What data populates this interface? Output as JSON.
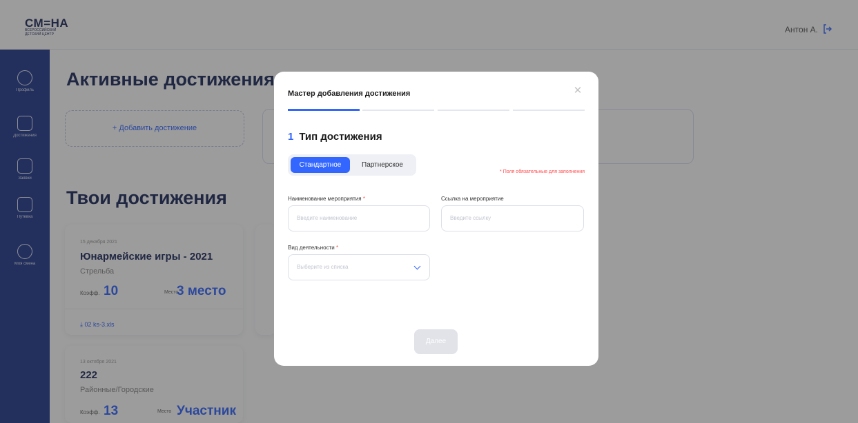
{
  "header": {
    "logo_main": "СМ=НА",
    "logo_sub1": "ВСЕРОССИЙСКИЙ",
    "logo_sub2": "ДЕТСКИЙ ЦЕНТР",
    "user_name": "Антон А."
  },
  "sidebar": {
    "items": [
      {
        "label": "Профиль",
        "icon": "profile-icon"
      },
      {
        "label": "Достижения",
        "icon": "trophy-icon"
      },
      {
        "label": "Заявки",
        "icon": "document-icon"
      },
      {
        "label": "Путевка",
        "icon": "voucher-icon"
      },
      {
        "label": "Моя смена",
        "icon": "shift-icon"
      }
    ]
  },
  "main": {
    "active_title": "Активные достижения",
    "add_label": "+ Добавить достижение",
    "my_title": "Твои достижения",
    "cards": [
      {
        "date": "15 декабря 2021",
        "title": "Юнармейские игры - 2021",
        "subtitle": "Стрельба",
        "coef_label": "Коэфф.",
        "coef_value": "10",
        "place_label": "Место",
        "place_value": "3 место",
        "file": "02 ks-3.xls"
      },
      {
        "date": "13 октября 2021",
        "title": "222",
        "subtitle": "Районные/Городские",
        "coef_label": "Коэфф.",
        "coef_value": "13",
        "place_label": "Место",
        "place_value": "Участник"
      }
    ]
  },
  "modal": {
    "title": "Мастер добавления достижения",
    "step_number": "1",
    "step_title": "Тип достижения",
    "toggle": [
      "Стандартное",
      "Партнерское"
    ],
    "required_note": "* Поля обязательные для заполнения",
    "event_name_label": "Наименование мероприятия",
    "event_name_placeholder": "Введите наименование",
    "event_link_label": "Ссылка на мероприятие",
    "event_link_placeholder": "Введите ссылку",
    "activity_label": "Вид деятельности",
    "activity_placeholder": "Выберите из списка",
    "required_mark": "*",
    "next_label": "Далее"
  }
}
